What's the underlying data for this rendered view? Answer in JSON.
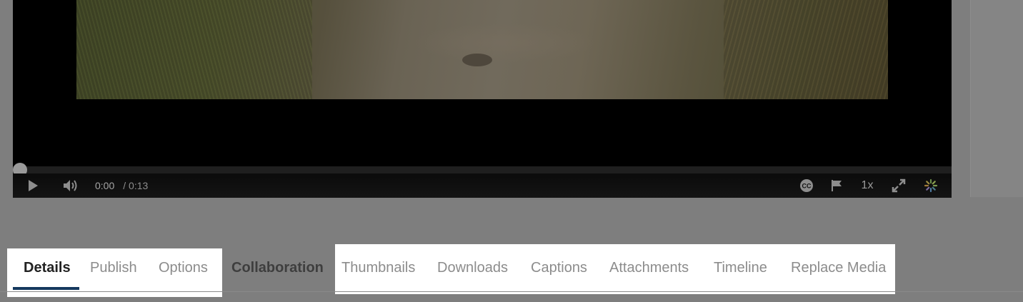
{
  "player": {
    "current_time": "0:00",
    "duration": "/ 0:13",
    "speed": "1x",
    "progress_fraction": 0.0,
    "icons": {
      "play": "play-icon",
      "volume": "volume-icon",
      "captions": "closed-captions-icon",
      "flag": "flag-icon",
      "fullscreen": "fullscreen-icon",
      "loading": "loading-spinner-icon"
    }
  },
  "tabs": [
    {
      "label": "Details",
      "state": "active"
    },
    {
      "label": "Publish",
      "state": "normal"
    },
    {
      "label": "Options",
      "state": "normal"
    },
    {
      "label": "Collaboration",
      "state": "disabled"
    },
    {
      "label": "Thumbnails",
      "state": "normal"
    },
    {
      "label": "Downloads",
      "state": "normal"
    },
    {
      "label": "Captions",
      "state": "normal"
    },
    {
      "label": "Attachments",
      "state": "normal"
    },
    {
      "label": "Timeline",
      "state": "normal"
    },
    {
      "label": "Replace Media",
      "state": "normal"
    }
  ],
  "colors": {
    "active_tab_underline": "#15385e",
    "page_overlay": "#7e7e7e"
  }
}
